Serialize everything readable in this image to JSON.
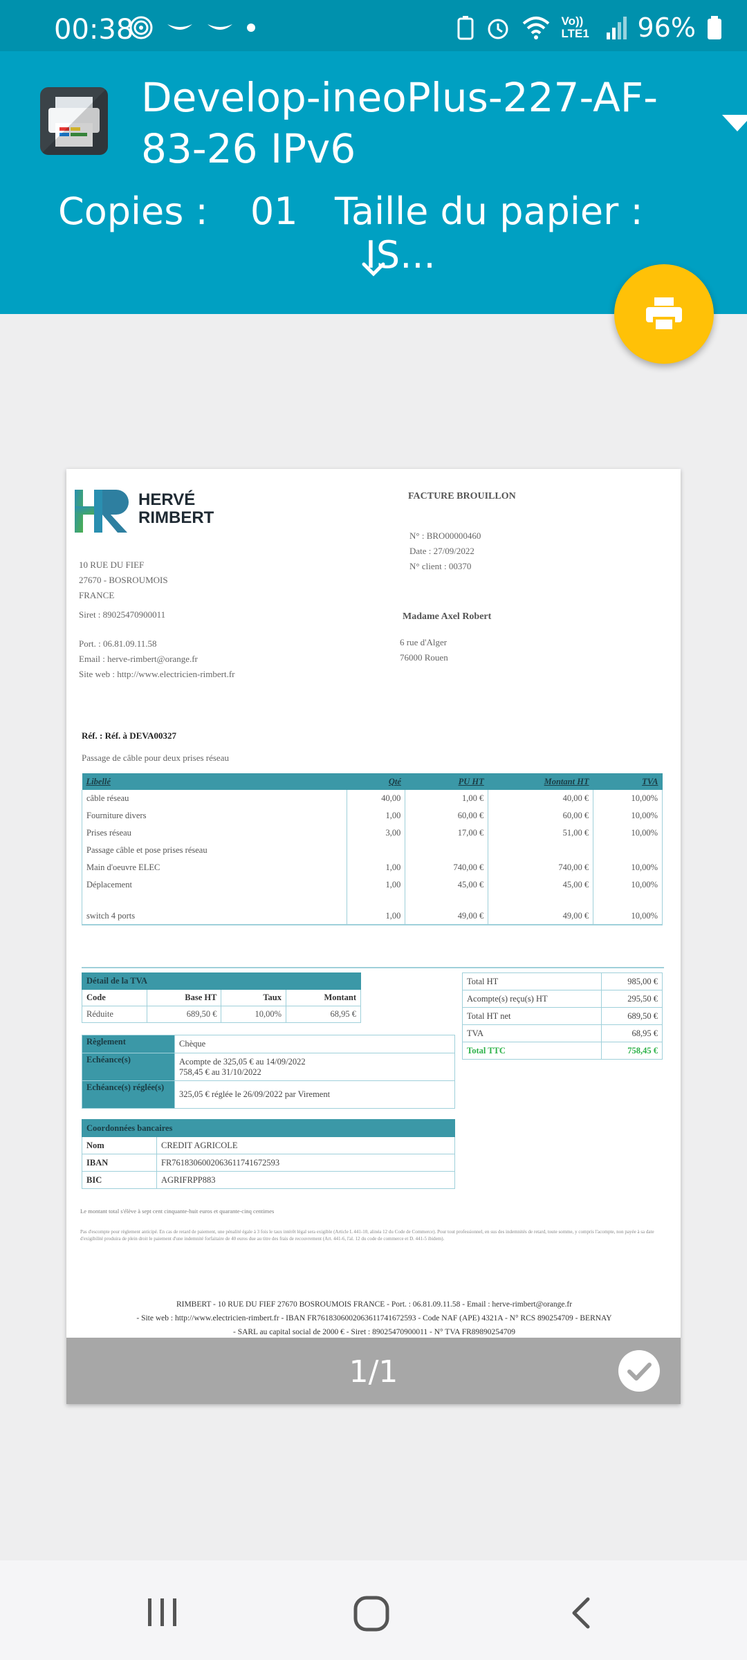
{
  "status_bar": {
    "time": "00:38",
    "network": "Vo)) LTE1",
    "battery": "96%"
  },
  "header": {
    "printer_name": "Develop-ineoPlus-227-AF-83-26 IPv6",
    "copies_label": "Copies :",
    "copies_value": "01",
    "paper_label": "Taille du papier :",
    "paper_value": "IS..."
  },
  "invoice": {
    "company_line1": "HERVÉ",
    "company_line2": "RIMBERT",
    "title": "FACTURE BROUILLON",
    "number": "N° : BRO00000460",
    "date": "Date : 27/09/2022",
    "client_no": "N° client : 00370",
    "sender": {
      "street": "10 RUE DU FIEF",
      "city": "27670 - BOSROUMOIS",
      "country": "FRANCE",
      "siret": "Siret : 89025470900011",
      "phone": "Port. : 06.81.09.11.58",
      "email": "Email : herve-rimbert@orange.fr",
      "web": "Site web : http://www.electricien-rimbert.fr"
    },
    "client": {
      "name": "Madame Axel Robert",
      "street": "6 rue d'Alger",
      "city": "76000 Rouen"
    },
    "ref": "Réf. : Réf. à DEVA00327",
    "ref_desc": "Passage de câble pour deux prises réseau",
    "lines_header": {
      "label": "Libellé",
      "qty": "Qté",
      "pu": "PU HT",
      "amount": "Montant HT",
      "tva": "TVA"
    },
    "lines": [
      {
        "label": "câble réseau",
        "qty": "40,00",
        "pu": "1,00 €",
        "amount": "40,00 €",
        "tva": "10,00%"
      },
      {
        "label": "Fourniture divers",
        "qty": "1,00",
        "pu": "60,00 €",
        "amount": "60,00 €",
        "tva": "10,00%"
      },
      {
        "label": "Prises réseau",
        "qty": "3,00",
        "pu": "17,00 €",
        "amount": "51,00 €",
        "tva": "10,00%"
      },
      {
        "label": "Passage câble et pose prises réseau",
        "qty": "",
        "pu": "",
        "amount": "",
        "tva": ""
      },
      {
        "label": "Main d'oeuvre ELEC",
        "qty": "1,00",
        "pu": "740,00 €",
        "amount": "740,00 €",
        "tva": "10,00%"
      },
      {
        "label": "Déplacement",
        "qty": "1,00",
        "pu": "45,00 €",
        "amount": "45,00 €",
        "tva": "10,00%"
      },
      {
        "label": "switch 4 ports",
        "qty": "1,00",
        "pu": "49,00 €",
        "amount": "49,00 €",
        "tva": "10,00%"
      }
    ],
    "tva_detail": {
      "title": "Détail de la TVA",
      "cols": [
        "Code",
        "Base HT",
        "Taux",
        "Montant"
      ],
      "row": [
        "Réduite",
        "689,50 €",
        "10,00%",
        "68,95 €"
      ]
    },
    "totals": [
      {
        "label": "Total HT",
        "value": "985,00 €"
      },
      {
        "label": "Acompte(s) reçu(s) HT",
        "value": "295,50 €"
      },
      {
        "label": "Total HT net",
        "value": "689,50 €"
      },
      {
        "label": "TVA",
        "value": "68,95 €"
      },
      {
        "label": "Total TTC",
        "value": "758,45 €"
      }
    ],
    "payment": {
      "method_label": "Règlement",
      "method_value": "Chèque",
      "due_label": "Echéance(s)",
      "due_line1": "Acompte de 325,05 € au 14/09/2022",
      "due_line2": "758,45 € au 31/10/2022",
      "paid_label": "Echéance(s) réglée(s)",
      "paid_value": "325,05 € réglée le 26/09/2022 par Virement"
    },
    "bank": {
      "title": "Coordonnées bancaires",
      "name_label": "Nom",
      "name_value": "CREDIT AGRICOLE",
      "iban_label": "IBAN",
      "iban_value": "FR7618306002063611741672593",
      "bic_label": "BIC",
      "bic_value": "AGRIFRPP883"
    },
    "amount_words": "Le montant total s'élève à sept cent cinquante-huit euros et quarante-cinq centimes",
    "small_print": "Pas d'escompte pour règlement anticipé. En cas de retard de paiement, une pénalité égale à 3 fois le taux intérêt légal sera exigible (Article L 441-10, alinéa 12 du Code de Commerce). Pour tout professionnel, en sus des indemnités de retard, toute somme, y compris l'acompte, non payée à sa date d'exigibilité produira de plein droit le paiement d'une indemnité forfaitaire de 40 euros due au titre des frais de recouvrement (Art. 441-6, l'al. 12 du code de commerce et D. 441-5 ibidem).",
    "footer_line1": "RIMBERT - 10 RUE DU FIEF 27670 BOSROUMOIS FRANCE - Port. : 06.81.09.11.58 - Email : herve-rimbert@orange.fr",
    "footer_line2": "- Site web : http://www.electricien-rimbert.fr - IBAN FR7618306002063611741672593 - Code NAF (APE) 4321A - N° RCS 890254709 - BERNAY",
    "footer_line3": "- SARL au capital social de 2000 € - Siret : 89025470900011 - N° TVA FR89890254709"
  },
  "preview": {
    "page_indicator": "1/1"
  },
  "colors": {
    "status_bar": "#0091ad",
    "header": "#00a0c2",
    "fab": "#ffc107",
    "table_header": "#3b98a7",
    "total_ttc": "#2eb24a"
  }
}
